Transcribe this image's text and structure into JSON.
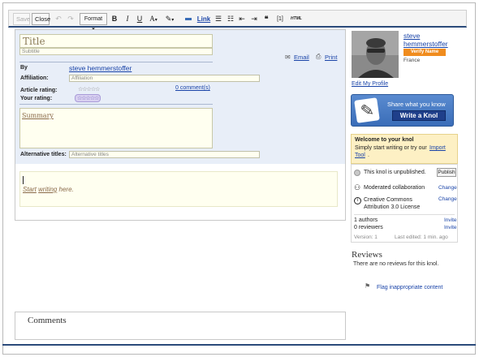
{
  "toolbar": {
    "save_label": "Save",
    "close_label": "Close",
    "format_label": "Format",
    "bold": "B",
    "italic": "I",
    "underline": "U",
    "font_color": "A",
    "link_label": "Link",
    "citation": "[1]",
    "html": "HTML"
  },
  "editor": {
    "title_placeholder": "Title",
    "subtitle_placeholder": "Subtitle",
    "email_label": "Email",
    "print_label": "Print",
    "by_label": "By",
    "author_name": "steve hemmerstoffer",
    "affiliation_label": "Affiliation:",
    "affiliation_placeholder": "Affiliation",
    "article_rating_label": "Article rating:",
    "article_stars": "☆☆☆☆☆",
    "comments_count": "0 comment(s)",
    "your_rating_label": "Your rating:",
    "your_stars": "☆☆☆☆☆",
    "summary_label": "Summary",
    "alt_titles_label": "Alternative titles:",
    "alt_titles_placeholder": "Alternative titles",
    "start_text_1": "Start",
    "start_text_2": "writing",
    "start_text_3": "here."
  },
  "profile": {
    "name_line1": "steve",
    "name_line2": "hemmerstoffer",
    "badge": "Verify Name",
    "country": "France",
    "edit_profile": "Edit My Profile"
  },
  "knol_button": {
    "tagline": "Share what you know",
    "label": "Write a Knol"
  },
  "welcome": {
    "title": "Welcome to your knol",
    "text": "Simply start writing or try our",
    "import_link_1": "Import",
    "import_link_2": "Tool",
    "period": "."
  },
  "status": {
    "unpublished": "This knol is unpublished.",
    "publish_button": "Publish",
    "collaboration": "Moderated collaboration",
    "change": "Change",
    "license_1": "Creative Commons",
    "license_2": "Attribution 3.0 License",
    "authors": "1 authors",
    "reviewers": "0 reviewers",
    "invite": "Invite",
    "version": "Version: 1",
    "last_edited": "Last edited: 1 min. ago"
  },
  "reviews": {
    "heading": "Reviews",
    "empty_text": "There are no reviews for this knol.",
    "flag_link": "Flag inappropriate content"
  },
  "comments": {
    "heading": "Comments"
  },
  "colors": {
    "link": "#1a44a8",
    "accent_blue": "#3a6db8",
    "badge_orange": "#f08c1e",
    "input_bg": "#fffff0",
    "meta_bg": "#e8eef8"
  }
}
